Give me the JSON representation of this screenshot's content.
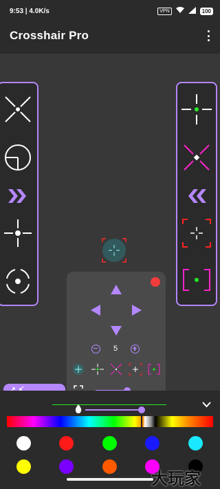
{
  "status": {
    "time": "9:53",
    "net_speed": "4.0K/s",
    "vpn": "VPN",
    "battery": "100"
  },
  "appbar": {
    "title": "Crosshair Pro",
    "menu_icon": "more-vert-icon"
  },
  "left_panel": {
    "items": [
      "x-crosshair-icon",
      "scope-circle-icon",
      "double-chevron-right-icon",
      "plus-dot-crosshair-icon",
      "circle-dot-crosshair-icon"
    ]
  },
  "right_panel": {
    "items": [
      "green-dot-cross-icon",
      "magenta-x-icon",
      "double-chevron-left-icon",
      "red-bracket-cross-icon",
      "magenta-bracket-green-dot-icon"
    ]
  },
  "controls": {
    "size_value": "5",
    "dot_color": "#f23b3b",
    "accent": "#b487ff"
  },
  "colors": {
    "accent": "#b487ff",
    "swatches_row1": [
      "#ffffff",
      "#ff1a1a",
      "#00ff00",
      "#1a1aff",
      "#1ae8ff"
    ],
    "swatches_row2": [
      "#ffff00",
      "#7a00ff",
      "#ff5a00",
      "#ff00ff",
      "#000000"
    ]
  },
  "watermark": "大玩家"
}
